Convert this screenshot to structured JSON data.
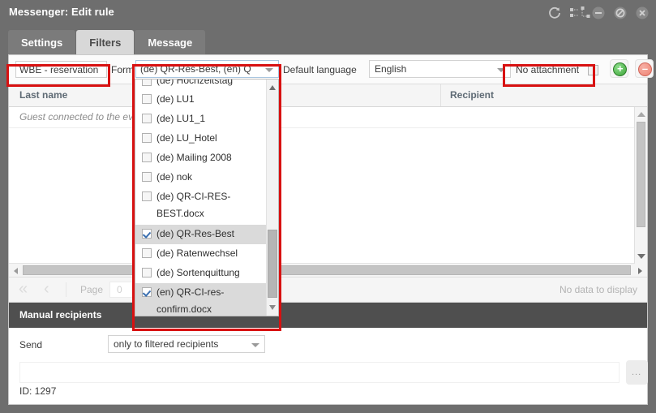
{
  "window": {
    "title": "Messenger: Edit rule",
    "icons": [
      {
        "name": "refresh-icon"
      },
      {
        "name": "layout-icon"
      },
      {
        "name": "minimize-icon"
      },
      {
        "name": "restore-icon"
      },
      {
        "name": "close-icon"
      }
    ]
  },
  "tabs": [
    {
      "label": "Settings",
      "active": false
    },
    {
      "label": "Filters",
      "active": true
    },
    {
      "label": "Message",
      "active": false
    }
  ],
  "toolbar": {
    "rule_name": "WBE - reservation",
    "form_label": "Form",
    "form_value": "(de) QR-Res-Best, (en) Q",
    "language_label": "Default language",
    "language_value": "English",
    "no_attachment_label": "No attachment",
    "no_attachment_checked": false,
    "add_label": "+",
    "remove_label": "–"
  },
  "dropdown": {
    "scroll_clipped_top_item": "(de) Hochzeitstag",
    "items": [
      {
        "label": "(de) LU1",
        "checked": false
      },
      {
        "label": "(de) LU1_1",
        "checked": false
      },
      {
        "label": "(de) LU_Hotel",
        "checked": false
      },
      {
        "label": "(de) Mailing 2008",
        "checked": false
      },
      {
        "label": "(de) nok",
        "checked": false
      },
      {
        "label": "(de) QR-CI-RES-BEST.docx",
        "checked": false
      },
      {
        "label": "(de) QR-Res-Best",
        "checked": true
      },
      {
        "label": "(de) Ratenwechsel",
        "checked": false
      },
      {
        "label": "(de) Sortenquittung",
        "checked": false
      },
      {
        "label": "(en) QR-CI-res-confirm.docx",
        "checked": true
      }
    ]
  },
  "grid": {
    "columns": [
      "Last name",
      "",
      "Recipient"
    ],
    "filter_row_text": "Guest connected to the ev",
    "empty_message": "No data to display"
  },
  "pager": {
    "first_label": "«",
    "prev_label": "‹",
    "page_label": "Page",
    "page_value": "0"
  },
  "manual_recipients": {
    "header": "Manual recipients",
    "send_label": "Send",
    "send_value": "only to filtered recipients",
    "recipients_value": "",
    "browse_label": "...",
    "id_text": "ID: 1297"
  },
  "colors": {
    "highlight": "#d81111",
    "chrome": "#6e6e6e",
    "active_tab": "#d8d8d8",
    "section_header": "#4f4f4f"
  }
}
